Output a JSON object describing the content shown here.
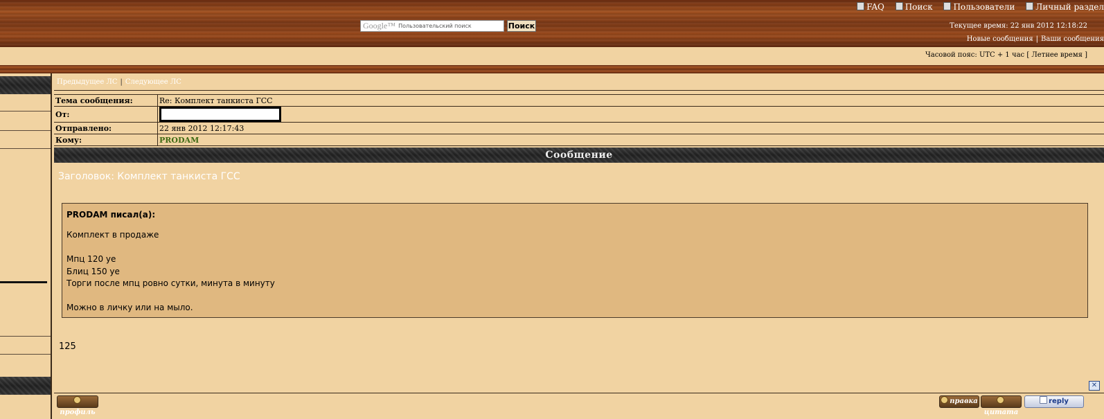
{
  "header": {
    "nav": {
      "faq": "FAQ",
      "search": "Поиск",
      "members": "Пользователи",
      "personal": "Личный раздел"
    },
    "search": {
      "logo": "Google™",
      "placeholder": "Пользовательский поиск",
      "button": "Поиск"
    },
    "current_time": "Текущее время: 22 янв 2012 12:18:22",
    "links": {
      "new_posts": "Новые сообщения",
      "your_posts": "Ваши сообщения"
    },
    "timezone": "Часовой пояс: UTC + 1 час [ Летнее время ]"
  },
  "pm_nav": {
    "prev": "Предыдущее ЛС",
    "sep": "|",
    "next": "Следующее ЛС"
  },
  "pm_header": {
    "subject_label": "Тема сообщения:",
    "subject_value": "Re: Комплект танкиста ГСС",
    "from_label": "От:",
    "sent_label": "Отправлено:",
    "sent_value": "22 янв 2012 12:17:43",
    "to_label": "Кому:",
    "to_value": "PRODAM"
  },
  "message": {
    "bar_title": "Сообщение",
    "subject_line": "Заголовок: Комплект танкиста ГСС",
    "quote_author": "PRODAM писал(а):",
    "quote_text": "Комплект в продаже\n\nМпц 120 уе\nБлиц 150 уе\nТорги после мпц ровно сутки, минута в минуту\n\nМожно в личку или на мыло.",
    "reply_text": "125",
    "close_symbol": "✕"
  },
  "buttons": {
    "profile": "профиль",
    "edit": "правка",
    "quote": "цитата",
    "reply": "reply"
  }
}
